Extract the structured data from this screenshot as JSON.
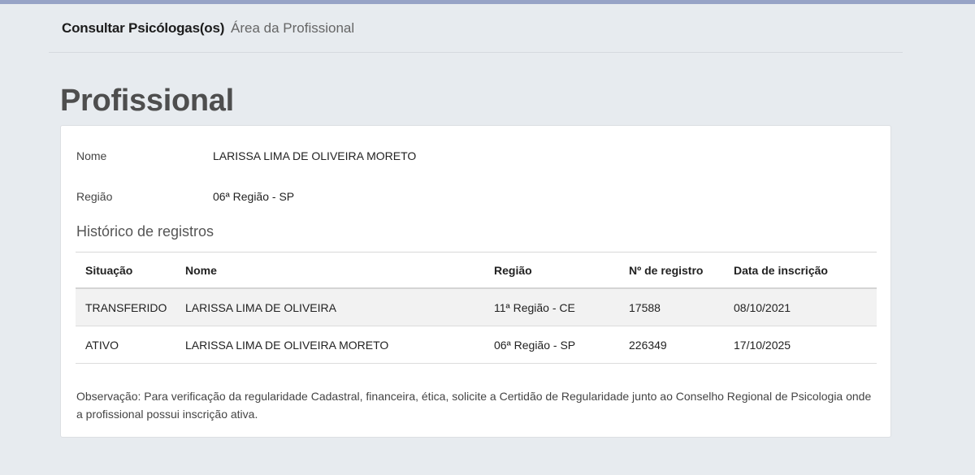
{
  "nav": {
    "items": [
      {
        "label": "Consultar Psicólogas(os)"
      },
      {
        "label": "Área da Profissional"
      }
    ]
  },
  "page": {
    "title": "Profissional"
  },
  "profile": {
    "name_label": "Nome",
    "name_value": "LARISSA LIMA DE OLIVEIRA MORETO",
    "region_label": "Região",
    "region_value": "06ª Região - SP"
  },
  "history": {
    "title": "Histórico de registros",
    "columns": [
      "Situação",
      "Nome",
      "Região",
      "Nº de registro",
      "Data de inscrição"
    ],
    "rows": [
      [
        "TRANSFERIDO",
        "LARISSA LIMA DE OLIVEIRA",
        "11ª Região - CE",
        "17588",
        "08/10/2021"
      ],
      [
        "ATIVO",
        "LARISSA LIMA DE OLIVEIRA MORETO",
        "06ª Região - SP",
        "226349",
        "17/10/2025"
      ]
    ]
  },
  "note": "Observação: Para verificação da regularidade Cadastral, financeira, ética, solicite a Certidão de Regularidade junto ao Conselho Regional de Psicologia onde a profissional possui inscrição ativa."
}
